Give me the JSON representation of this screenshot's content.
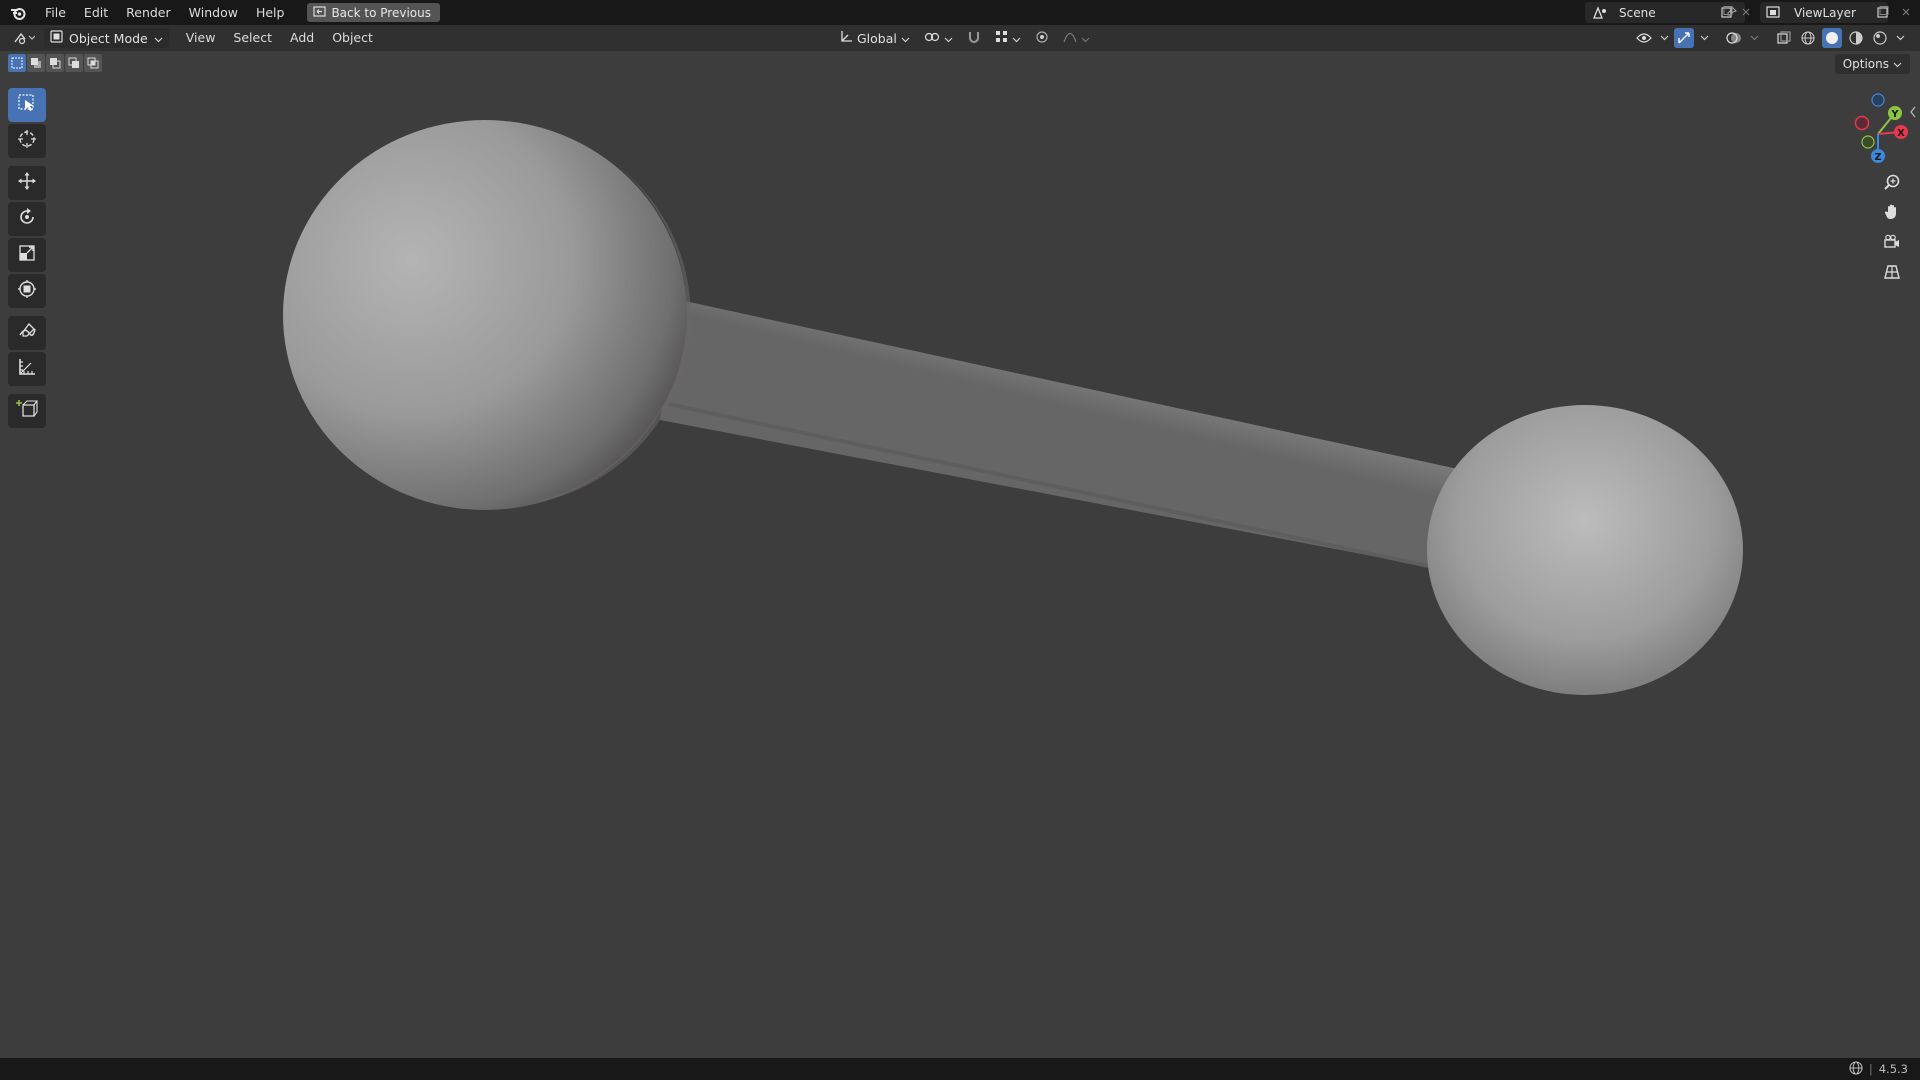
{
  "topbar": {
    "menus": [
      "File",
      "Edit",
      "Render",
      "Window",
      "Help"
    ],
    "back_label": "Back to Previous",
    "scene_name": "Scene",
    "view_layer": "ViewLayer"
  },
  "header": {
    "mode_label": "Object Mode",
    "menus": [
      "View",
      "Select",
      "Add",
      "Object"
    ],
    "orientation_label": "Global",
    "options_label": "Options"
  },
  "statusbar": {
    "version": "4.5.3"
  },
  "colors": {
    "accent": "#4772b3",
    "axis_x": "#e8384f",
    "axis_y": "#8cc63f",
    "axis_z": "#3b88e0",
    "background": "#3d3d3d"
  }
}
